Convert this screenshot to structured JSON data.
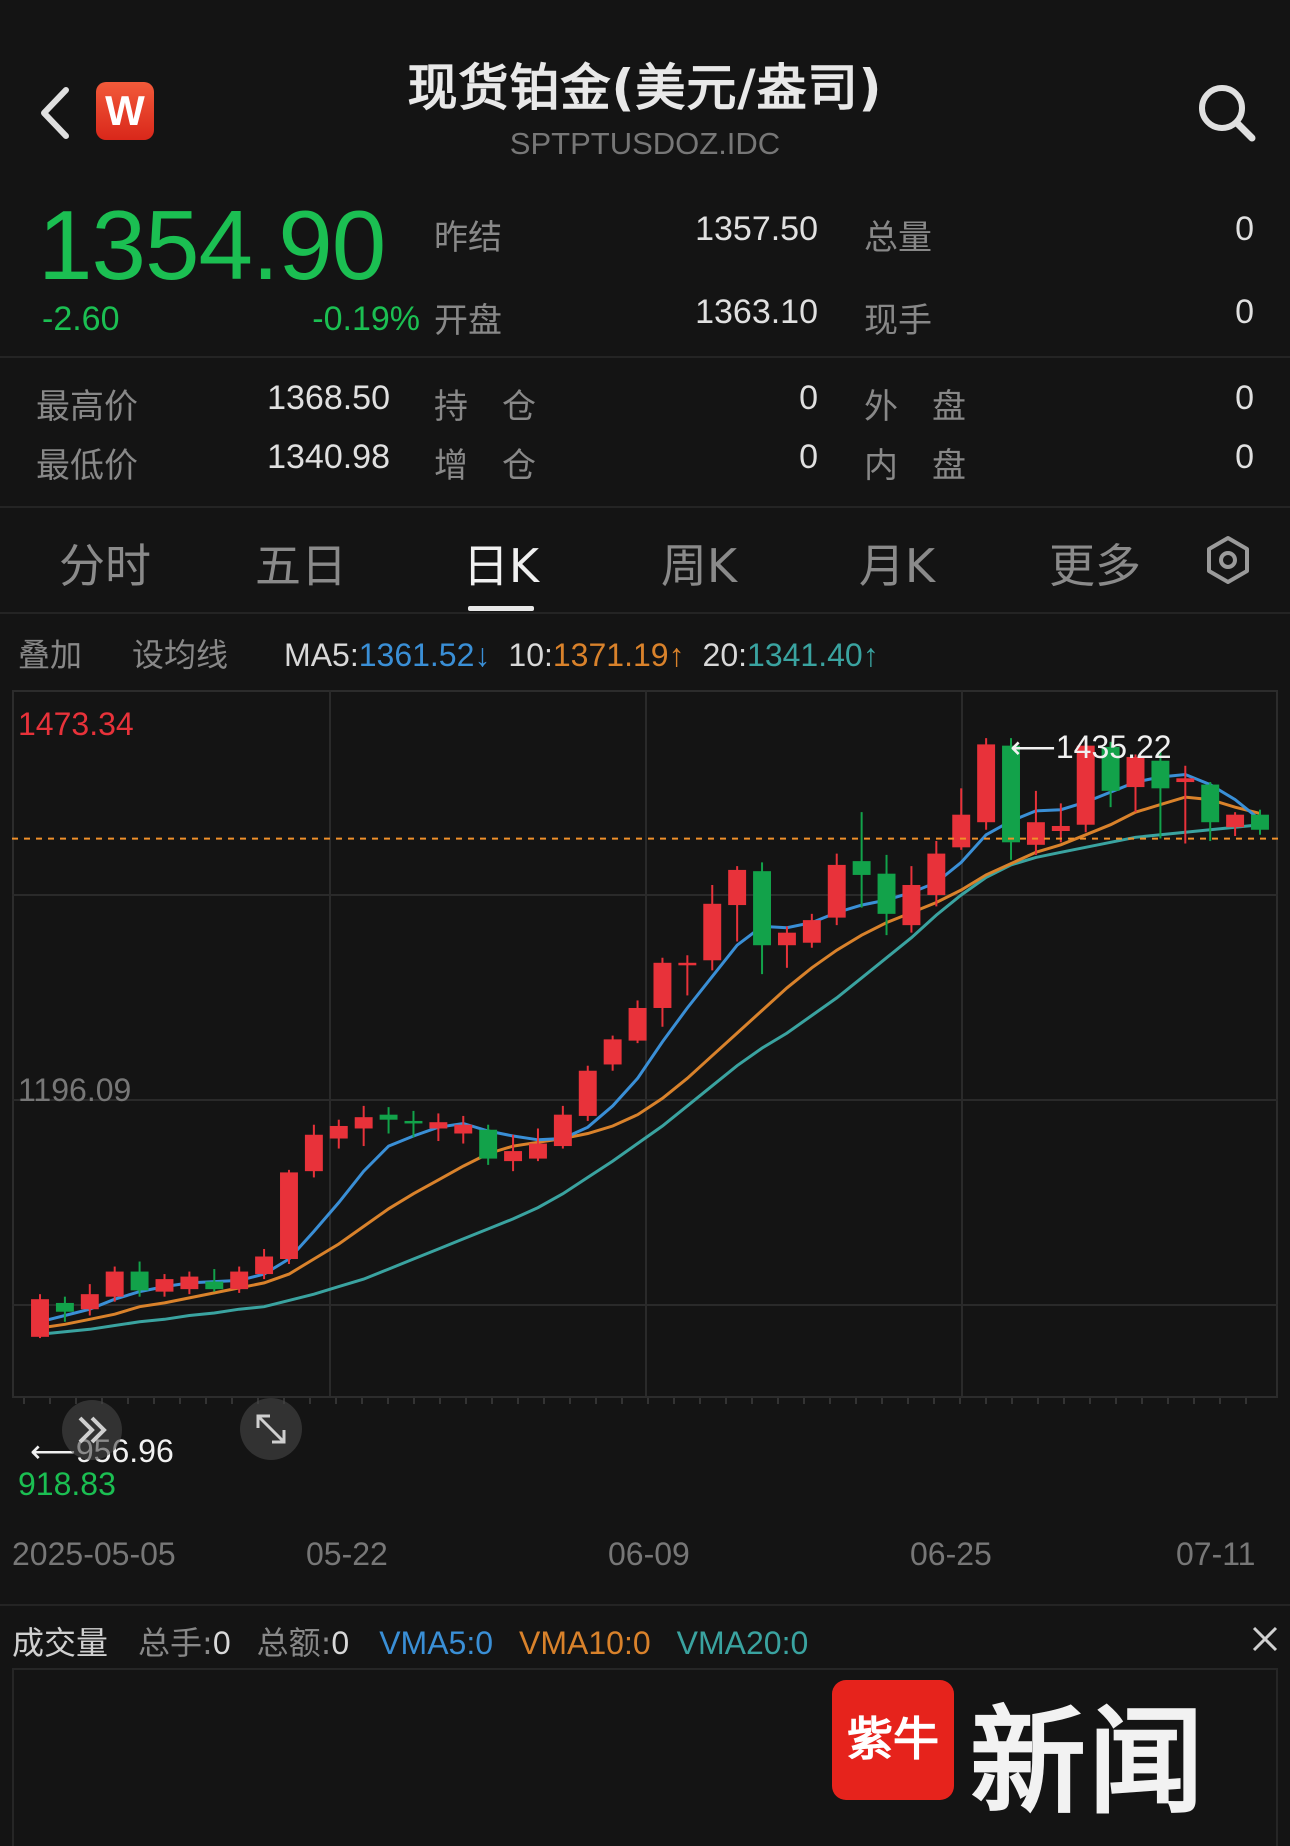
{
  "header": {
    "badge_letter": "W",
    "title": "现货铂金(美元/盎司)",
    "symbol": "SPTPTUSDOZ.IDC"
  },
  "quote": {
    "price": "1354.90",
    "change": "-2.60",
    "change_pct": "-0.19%",
    "fields": [
      {
        "label": "昨结",
        "value": "1357.50"
      },
      {
        "label": "开盘",
        "value": "1363.10"
      },
      {
        "label": "总量",
        "value": "0"
      },
      {
        "label": "现手",
        "value": "0"
      },
      {
        "label": "最高价",
        "value": "1368.50"
      },
      {
        "label": "最低价",
        "value": "1340.98"
      },
      {
        "label": "持　仓",
        "value": "0"
      },
      {
        "label": "增　仓",
        "value": "0"
      },
      {
        "label": "外　盘",
        "value": "0"
      },
      {
        "label": "内　盘",
        "value": "0"
      }
    ]
  },
  "tabs": [
    "分时",
    "五日",
    "日K",
    "周K",
    "月K",
    "更多"
  ],
  "active_tab": "日K",
  "indicators": {
    "overlay": "叠加",
    "set_ma": "设均线",
    "ma5_label": "MA5:",
    "ma5_value": "1361.52↓",
    "ma10_label": "10:",
    "ma10_value": "1371.19↑",
    "ma20_label": "20:",
    "ma20_value": "1341.40↑"
  },
  "colors": {
    "up": "#e8323a",
    "down": "#12a24a",
    "ma5": "#3a8fd6",
    "ma10": "#d9822b",
    "ma20": "#3aa3a0",
    "price_line": "#f0902a"
  },
  "chart_data": {
    "type": "candlestick",
    "y_max_label": "1473.34",
    "y_mid_label": "1196.09",
    "y_min_label": "918.83",
    "high_marker": "1435.22",
    "low_marker": "956.96",
    "x_labels": [
      "2025-05-05",
      "05-22",
      "06-09",
      "06-25",
      "07-11"
    ],
    "ylim": [
      918.83,
      1473.34
    ],
    "candles": [
      {
        "o": 958,
        "c": 988,
        "h": 992,
        "l": 957
      },
      {
        "o": 985,
        "c": 978,
        "h": 990,
        "l": 970
      },
      {
        "o": 980,
        "c": 992,
        "h": 1000,
        "l": 975
      },
      {
        "o": 990,
        "c": 1010,
        "h": 1014,
        "l": 986
      },
      {
        "o": 1010,
        "c": 995,
        "h": 1018,
        "l": 990
      },
      {
        "o": 994,
        "c": 1004,
        "h": 1008,
        "l": 990
      },
      {
        "o": 996,
        "c": 1006,
        "h": 1010,
        "l": 992
      },
      {
        "o": 1002,
        "c": 996,
        "h": 1012,
        "l": 994
      },
      {
        "o": 996,
        "c": 1010,
        "h": 1014,
        "l": 993
      },
      {
        "o": 1008,
        "c": 1022,
        "h": 1028,
        "l": 1004
      },
      {
        "o": 1020,
        "c": 1089,
        "h": 1091,
        "l": 1016
      },
      {
        "o": 1090,
        "c": 1119,
        "h": 1127,
        "l": 1085
      },
      {
        "o": 1116,
        "c": 1126,
        "h": 1131,
        "l": 1108
      },
      {
        "o": 1124,
        "c": 1133,
        "h": 1142,
        "l": 1110
      },
      {
        "o": 1135,
        "c": 1131,
        "h": 1141,
        "l": 1120
      },
      {
        "o": 1130,
        "c": 1128,
        "h": 1138,
        "l": 1117
      },
      {
        "o": 1124,
        "c": 1129,
        "h": 1136,
        "l": 1114
      },
      {
        "o": 1120,
        "c": 1127,
        "h": 1134,
        "l": 1112
      },
      {
        "o": 1123,
        "c": 1100,
        "h": 1127,
        "l": 1095
      },
      {
        "o": 1098,
        "c": 1106,
        "h": 1119,
        "l": 1090
      },
      {
        "o": 1100,
        "c": 1112,
        "h": 1124,
        "l": 1098
      },
      {
        "o": 1110,
        "c": 1135,
        "h": 1142,
        "l": 1108
      },
      {
        "o": 1134,
        "c": 1170,
        "h": 1174,
        "l": 1130
      },
      {
        "o": 1175,
        "c": 1195,
        "h": 1198,
        "l": 1170
      },
      {
        "o": 1194,
        "c": 1220,
        "h": 1226,
        "l": 1192
      },
      {
        "o": 1220,
        "c": 1256,
        "h": 1260,
        "l": 1205
      },
      {
        "o": 1254,
        "c": 1256,
        "h": 1262,
        "l": 1230
      },
      {
        "o": 1258,
        "c": 1303,
        "h": 1318,
        "l": 1250
      },
      {
        "o": 1302,
        "c": 1330,
        "h": 1333,
        "l": 1273
      },
      {
        "o": 1329,
        "c": 1270,
        "h": 1336,
        "l": 1247
      },
      {
        "o": 1270,
        "c": 1280,
        "h": 1285,
        "l": 1252
      },
      {
        "o": 1272,
        "c": 1290,
        "h": 1295,
        "l": 1268
      },
      {
        "o": 1292,
        "c": 1334,
        "h": 1343,
        "l": 1286
      },
      {
        "o": 1337,
        "c": 1326,
        "h": 1376,
        "l": 1300
      },
      {
        "o": 1327,
        "c": 1295,
        "h": 1342,
        "l": 1278
      },
      {
        "o": 1286,
        "c": 1318,
        "h": 1333,
        "l": 1280
      },
      {
        "o": 1310,
        "c": 1343,
        "h": 1353,
        "l": 1301
      },
      {
        "o": 1348,
        "c": 1374,
        "h": 1395,
        "l": 1346
      },
      {
        "o": 1368,
        "c": 1430,
        "h": 1435,
        "l": 1362
      },
      {
        "o": 1429,
        "c": 1352,
        "h": 1435,
        "l": 1338
      },
      {
        "o": 1350,
        "c": 1368,
        "h": 1393,
        "l": 1342
      },
      {
        "o": 1361,
        "c": 1365,
        "h": 1383,
        "l": 1352
      },
      {
        "o": 1366,
        "c": 1429,
        "h": 1434,
        "l": 1360
      },
      {
        "o": 1428,
        "c": 1393,
        "h": 1432,
        "l": 1380
      },
      {
        "o": 1396,
        "c": 1420,
        "h": 1422,
        "l": 1376
      },
      {
        "o": 1417,
        "c": 1395,
        "h": 1424,
        "l": 1355
      },
      {
        "o": 1400,
        "c": 1403,
        "h": 1413,
        "l": 1351
      },
      {
        "o": 1398,
        "c": 1368,
        "h": 1400,
        "l": 1353
      },
      {
        "o": 1364,
        "c": 1374,
        "h": 1376,
        "l": 1357
      },
      {
        "o": 1374,
        "c": 1362,
        "h": 1378,
        "l": 1358
      }
    ],
    "ma5": [
      970,
      975,
      980,
      988,
      994,
      998,
      1001,
      1002,
      1003,
      1008,
      1020,
      1042,
      1065,
      1090,
      1110,
      1118,
      1125,
      1128,
      1122,
      1118,
      1115,
      1116,
      1125,
      1142,
      1164,
      1193,
      1220,
      1245,
      1270,
      1285,
      1284,
      1288,
      1296,
      1302,
      1306,
      1312,
      1320,
      1336,
      1358,
      1369,
      1377,
      1378,
      1384,
      1392,
      1400,
      1404,
      1406,
      1398,
      1386,
      1370
    ],
    "ma10": [
      965,
      968,
      972,
      976,
      982,
      985,
      989,
      993,
      997,
      1001,
      1008,
      1020,
      1032,
      1046,
      1060,
      1072,
      1083,
      1094,
      1104,
      1110,
      1113,
      1116,
      1120,
      1126,
      1135,
      1148,
      1164,
      1182,
      1200,
      1218,
      1236,
      1252,
      1266,
      1278,
      1288,
      1296,
      1304,
      1314,
      1326,
      1335,
      1344,
      1350,
      1358,
      1366,
      1376,
      1382,
      1388,
      1386,
      1380,
      1375
    ],
    "ma20": [
      960,
      962,
      964,
      967,
      970,
      972,
      975,
      977,
      980,
      982,
      987,
      992,
      998,
      1004,
      1012,
      1020,
      1028,
      1036,
      1044,
      1052,
      1061,
      1072,
      1085,
      1098,
      1112,
      1126,
      1142,
      1158,
      1174,
      1188,
      1200,
      1214,
      1228,
      1244,
      1260,
      1276,
      1294,
      1310,
      1324,
      1334,
      1340,
      1344,
      1348,
      1352,
      1356,
      1358,
      1360,
      1362,
      1364,
      1366
    ],
    "current_price": 1354.9
  },
  "volume": {
    "title": "成交量",
    "total_hands_label": "总手:",
    "total_hands": "0",
    "total_amount_label": "总额:",
    "total_amount": "0",
    "vma5_label": "VMA5:",
    "vma5": "0",
    "vma10_label": "VMA10:",
    "vma10": "0",
    "vma20_label": "VMA20:",
    "vma20": "0"
  },
  "watermark": {
    "badge_text": "紫牛",
    "text": "新闻"
  }
}
